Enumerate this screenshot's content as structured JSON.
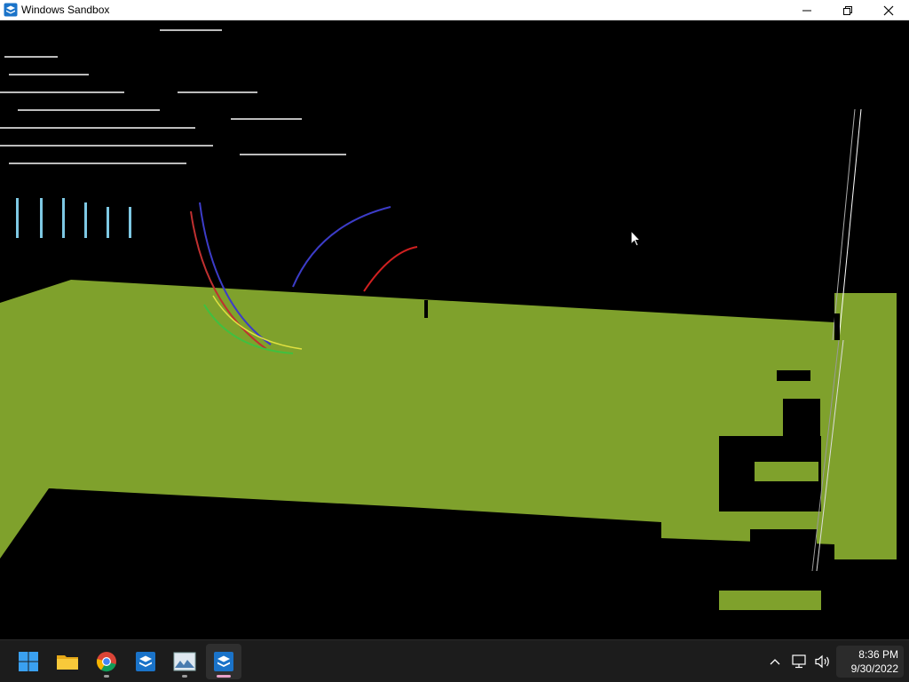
{
  "window": {
    "title": "Windows Sandbox",
    "controls": [
      "minimize",
      "restore",
      "close"
    ]
  },
  "taskbar": {
    "apps": [
      {
        "name": "start",
        "icon": "windows-logo-icon"
      },
      {
        "name": "file-explorer",
        "icon": "folder-icon"
      },
      {
        "name": "chrome",
        "icon": "chrome-icon"
      },
      {
        "name": "windows-sandbox",
        "icon": "sandbox-icon"
      },
      {
        "name": "image-viewer",
        "icon": "image-icon"
      },
      {
        "name": "windows-sandbox-active",
        "icon": "sandbox-icon"
      }
    ],
    "clock": {
      "time": "8:36 PM",
      "date": "9/30/2022"
    }
  },
  "colors": {
    "ground_green": "#7fa12c",
    "background": "#000000",
    "taskbar": "#1c1c1c",
    "accent": "#0a64c8",
    "active_indicator": "#e8a0c8"
  }
}
